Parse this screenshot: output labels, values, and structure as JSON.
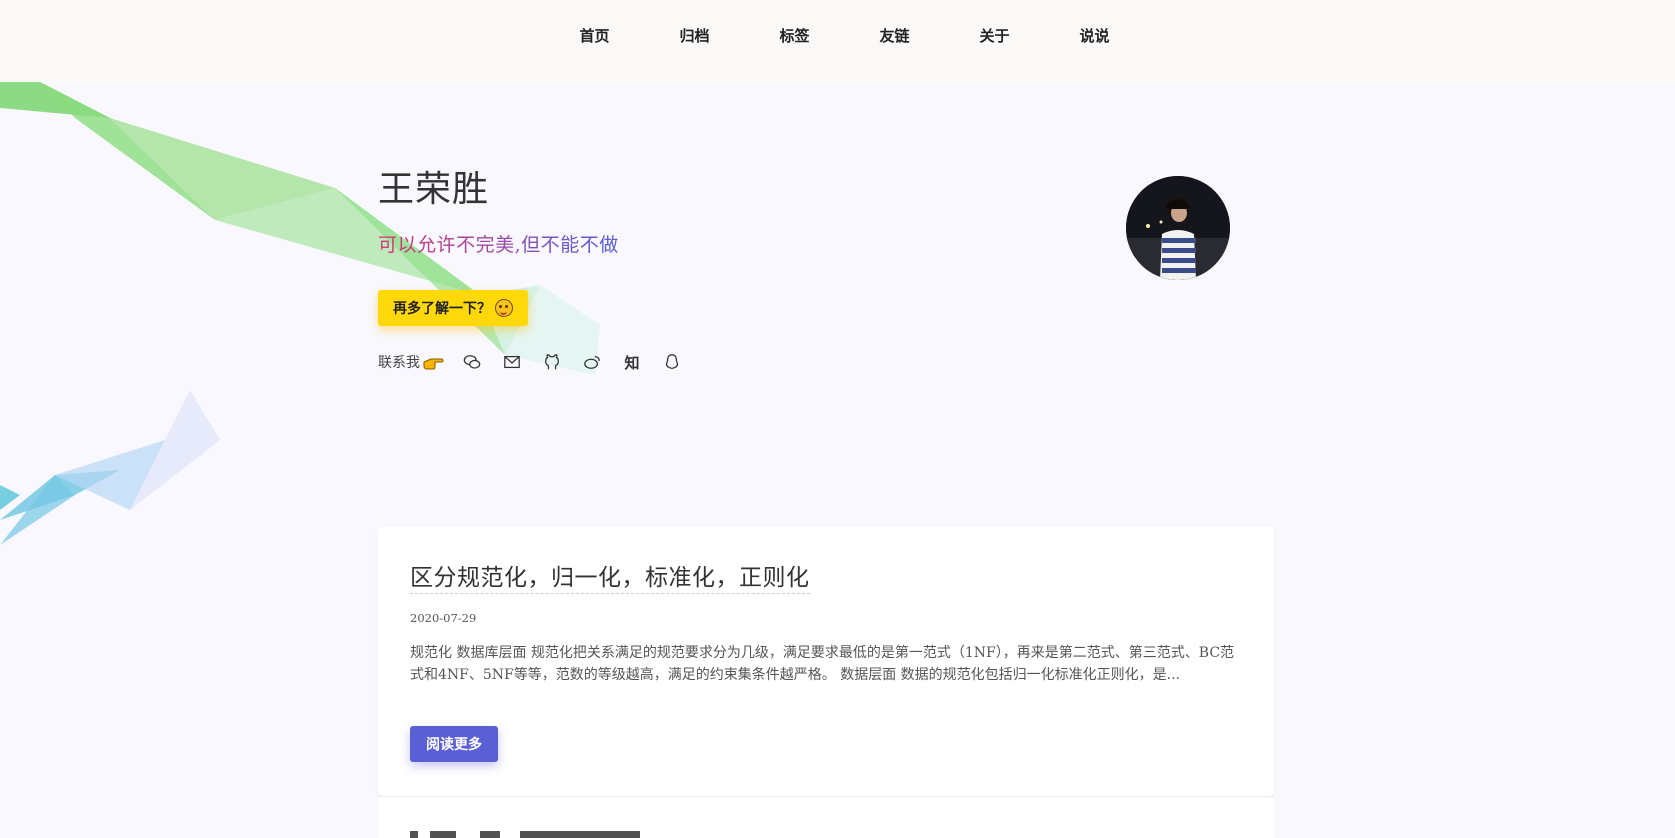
{
  "nav": {
    "items": [
      {
        "label": "首页"
      },
      {
        "label": "归档"
      },
      {
        "label": "标签"
      },
      {
        "label": "友链"
      },
      {
        "label": "关于"
      },
      {
        "label": "说说"
      }
    ]
  },
  "hero": {
    "title": "王荣胜",
    "motto": "可以允许不完美,但不能不做",
    "cta_label": "再多了解一下？",
    "cta_icon": "grinning-emoji-icon",
    "contact_label": "联系我",
    "contact_icons": [
      "pointing-hand-icon",
      "wechat-icon",
      "mail-icon",
      "github-icon",
      "weibo-icon",
      "zhihu-icon",
      "qq-icon"
    ],
    "zhihu_text": "知"
  },
  "posts": [
    {
      "title": "区分规范化，归一化，标准化，正则化",
      "date": "2020-07-29",
      "excerpt": "规范化 数据库层面 规范化把关系满足的规范要求分为几级，满足要求最低的是第一范式（1NF），再来是第二范式、第三范式、BC范式和4NF、5NF等等，范数的等级越高，满足的约束集条件越严格。 数据层面 数据的规范化包括归一化标准化正则化，是...",
      "read_more": "阅读更多"
    }
  ],
  "colors": {
    "accent": "#5b5fd6",
    "cta": "#ffd80a",
    "motto_start": "#d4387a",
    "motto_end": "#5b5fd6"
  }
}
